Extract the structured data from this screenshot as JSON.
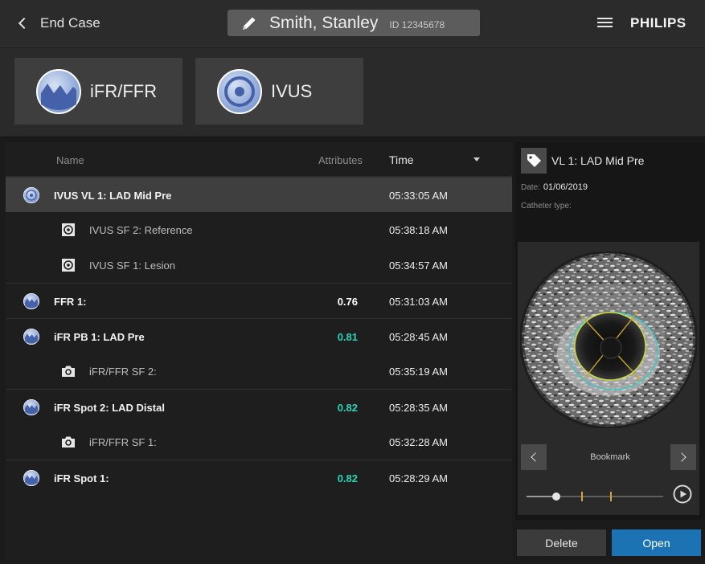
{
  "header": {
    "back_label": "End Case",
    "patient_name": "Smith, Stanley",
    "patient_id": "ID 12345678",
    "brand": "PHILIPS"
  },
  "modes": [
    {
      "label": "iFR/FFR",
      "icon": "pressure-wave-icon"
    },
    {
      "label": "IVUS",
      "icon": "ivus-target-icon"
    }
  ],
  "list": {
    "columns": {
      "name": "Name",
      "attributes": "Attributes",
      "time": "Time"
    },
    "rows": [
      {
        "level": "parent",
        "icon": "ivus-target-icon",
        "name": "IVUS VL 1: LAD Mid Pre",
        "value": "",
        "value_color": "#ffffff",
        "time": "05:33:05 AM",
        "selected": true
      },
      {
        "level": "child",
        "icon": "snapshot-frame-icon",
        "name": "IVUS  SF 2: Reference",
        "value": "",
        "value_color": "#ffffff",
        "time": "05:38:18 AM",
        "selected": false
      },
      {
        "level": "child",
        "icon": "snapshot-frame-icon",
        "name": "IVUS  SF 1: Lesion",
        "value": "",
        "value_color": "#ffffff",
        "time": "05:34:57 AM",
        "selected": false
      },
      {
        "level": "parent",
        "icon": "pressure-wave-icon",
        "name": "FFR 1:",
        "value": "0.76",
        "value_color": "#ffffff",
        "time": "05:31:03 AM",
        "selected": false
      },
      {
        "level": "parent",
        "icon": "pressure-wave-icon",
        "name": "iFR PB 1: LAD Pre",
        "value": "0.81",
        "value_color": "#2ed3b7",
        "time": "05:28:45 AM",
        "selected": false
      },
      {
        "level": "child",
        "icon": "camera-icon",
        "name": "iFR/FFR SF 2:",
        "value": "",
        "value_color": "#ffffff",
        "time": "05:35:19 AM",
        "selected": false
      },
      {
        "level": "parent",
        "icon": "pressure-wave-icon",
        "name": "iFR Spot 2: LAD Distal",
        "value": "0.82",
        "value_color": "#2ed3b7",
        "time": "05:28:35 AM",
        "selected": false
      },
      {
        "level": "child",
        "icon": "camera-icon",
        "name": "iFR/FFR SF 1:",
        "value": "",
        "value_color": "#ffffff",
        "time": "05:32:28 AM",
        "selected": false
      },
      {
        "level": "parent",
        "icon": "pressure-wave-icon",
        "name": "iFR Spot 1:",
        "value": "0.82",
        "value_color": "#2ed3b7",
        "time": "05:28:29 AM",
        "selected": false
      }
    ]
  },
  "preview": {
    "title": "VL 1: LAD Mid Pre",
    "date_label": "Date:",
    "date_value": "01/06/2019",
    "catheter_label": "Catheter type:",
    "catheter_value": "",
    "bookmark_label": "Bookmark",
    "playback_progress": 0.22,
    "bookmark_positions": [
      0.4,
      0.61
    ]
  },
  "actions": {
    "delete_label": "Delete",
    "open_label": "Open"
  },
  "colors": {
    "accent_blue": "#1b73b3",
    "value_teal": "#2ed3b7",
    "bookmark_gold": "#d4a72c"
  }
}
